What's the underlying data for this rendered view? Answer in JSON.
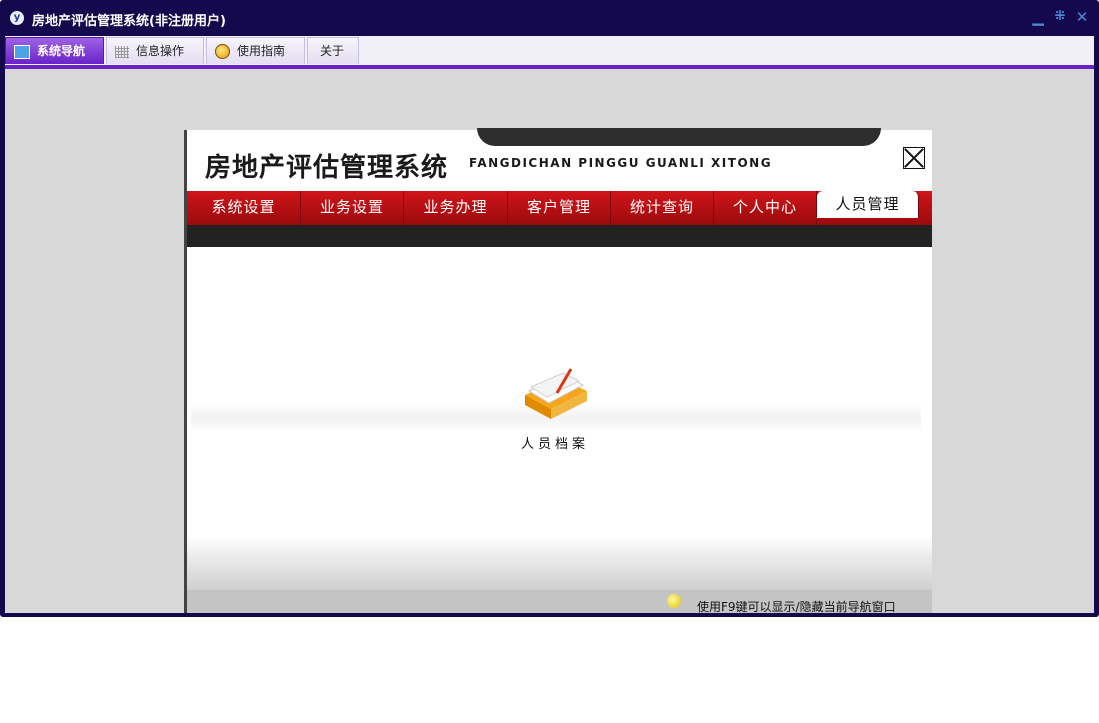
{
  "window": {
    "title": "房地产评估管理系统(非注册用户)",
    "icon": "app-logo-icon",
    "controls": [
      "minimize-icon",
      "restore-icon",
      "close-icon"
    ]
  },
  "tabs": [
    {
      "label": "系统导航",
      "icon": "monitor-icon",
      "active": true
    },
    {
      "label": "信息操作",
      "icon": "grid-icon",
      "active": false
    },
    {
      "label": "使用指南",
      "icon": "help-globe-icon",
      "active": false
    },
    {
      "label": "关于",
      "icon": "",
      "active": false
    }
  ],
  "app": {
    "title": "房地产评估管理系统",
    "subtitle": "FANGDICHAN PINGGU GUANLI XITONG",
    "menu": [
      "系统设置",
      "业务设置",
      "业务办理",
      "客户管理",
      "统计查询",
      "个人中心",
      "人员管理"
    ],
    "selected_menu": "人员管理",
    "content_item": {
      "label": "人员档案",
      "icon": "book-folder-icon"
    },
    "status_hint": "使用F9键可以显示/隐藏当前导航窗口"
  },
  "colors": {
    "title_bar": "#15094e",
    "tab_accent": "#6a22c8",
    "menu_red": "#c8161c"
  }
}
